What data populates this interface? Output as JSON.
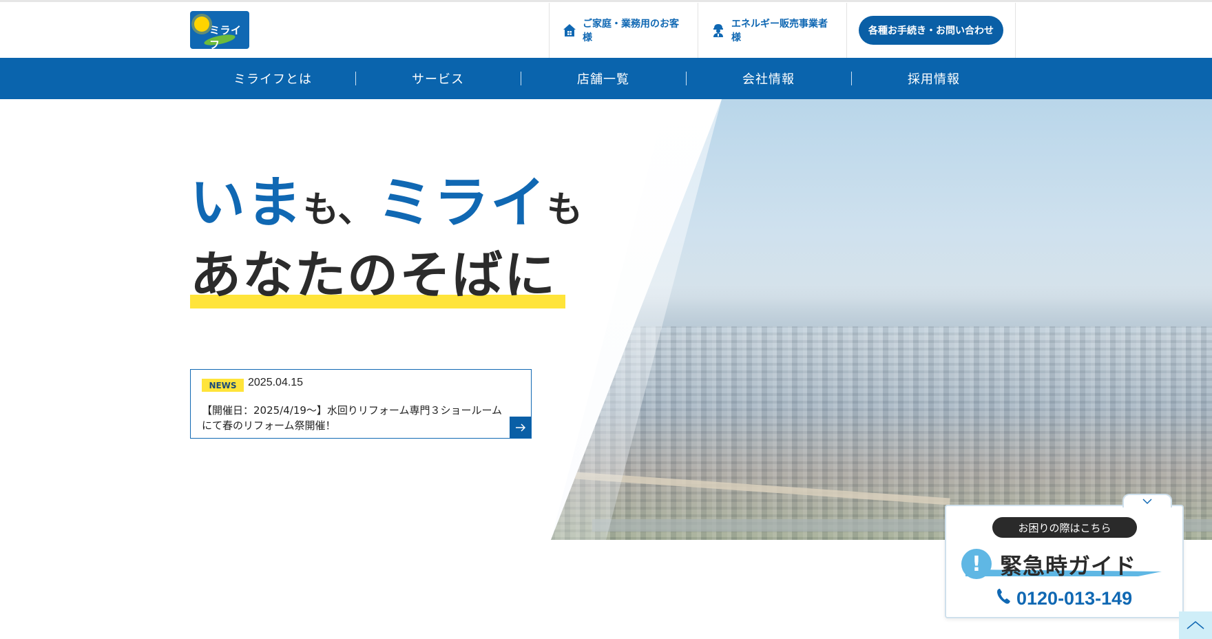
{
  "header": {
    "logo_text": "ミライフ",
    "nav_home": "ご家庭・業務用のお客様",
    "nav_energy": "エネルギー販売事業者様",
    "cta": "各種お手続き・お問い合わせ"
  },
  "mainnav": {
    "items": [
      {
        "label": "ミライフとは"
      },
      {
        "label": "サービス"
      },
      {
        "label": "店舗一覧"
      },
      {
        "label": "会社情報"
      },
      {
        "label": "採用情報"
      }
    ]
  },
  "hero": {
    "catch_part1": "いま",
    "catch_part2": "も、",
    "catch_part3": "ミライ",
    "catch_part4": "も",
    "catch_line2": "あなたのそばに"
  },
  "news": {
    "badge": "NEWS",
    "date": "2025.04.15",
    "title": "【開催日：2025/4/19〜】水回りリフォーム専門３ショールームにて春のリフォーム祭開催！"
  },
  "emergency": {
    "pill": "お困りの際はこちら",
    "title": "緊急時ガイド",
    "phone": "0120-013-149"
  },
  "colors": {
    "brand_blue": "#0a64ad",
    "accent_yellow": "#ffe43a",
    "accent_light_blue": "#5fb7e4"
  },
  "icons": {
    "home": "house-icon",
    "energy": "worker-icon",
    "phone": "phone-icon",
    "arrow": "arrow-right-icon",
    "chevron": "chevron-down-icon",
    "top": "chevron-up-icon"
  }
}
